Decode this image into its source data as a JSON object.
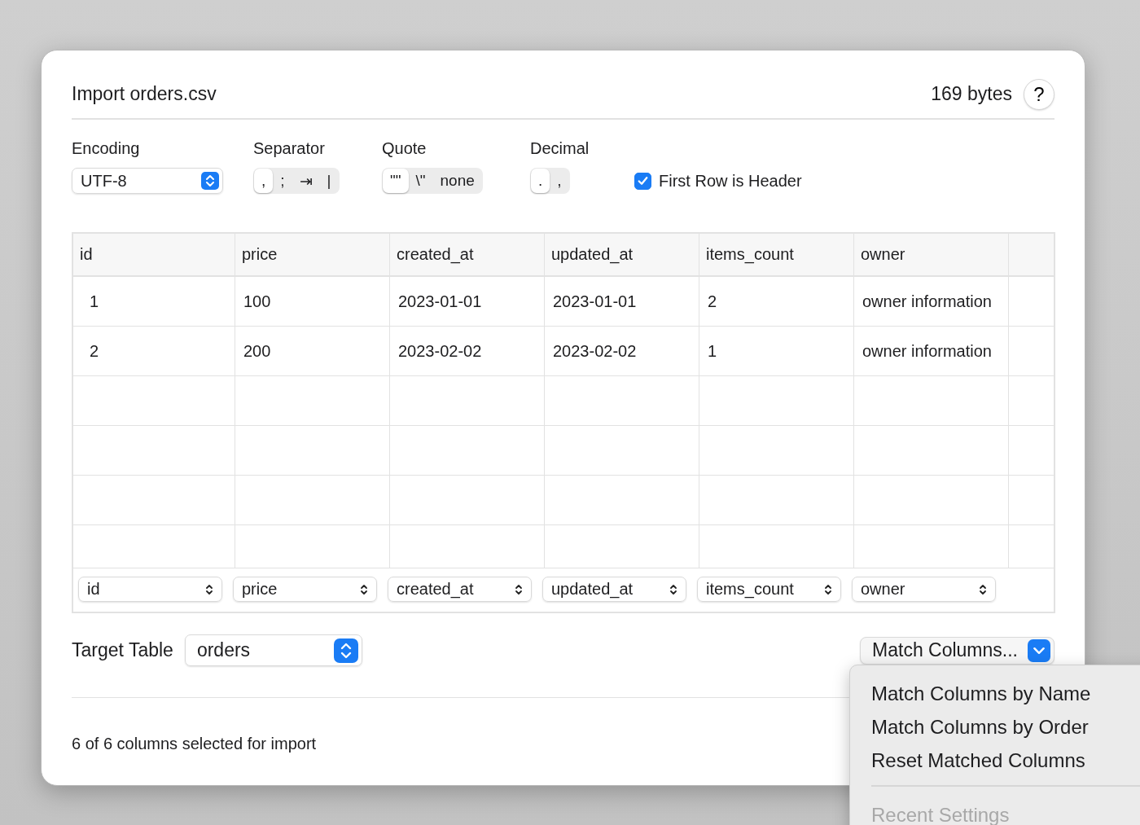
{
  "dialog": {
    "title": "Import orders.csv",
    "size": "169 bytes",
    "help": "?"
  },
  "options": {
    "encoding": {
      "label": "Encoding",
      "value": "UTF-8"
    },
    "separator": {
      "label": "Separator",
      "segments": [
        {
          "label": ",",
          "selected": true
        },
        {
          "label": ";",
          "selected": false
        },
        {
          "label": "⇥",
          "selected": false
        },
        {
          "label": "|",
          "selected": false
        }
      ]
    },
    "quote": {
      "label": "Quote",
      "segments": [
        {
          "label": "\"\"",
          "selected": true
        },
        {
          "label": "\\\"",
          "selected": false
        },
        {
          "label": "none",
          "selected": false
        }
      ]
    },
    "decimal": {
      "label": "Decimal",
      "segments": [
        {
          "label": ".",
          "selected": true
        },
        {
          "label": ",",
          "selected": false
        }
      ]
    },
    "header_checkbox": {
      "label": "First Row is Header",
      "checked": true
    }
  },
  "table": {
    "columns": [
      "id",
      "price",
      "created_at",
      "updated_at",
      "items_count",
      "owner"
    ],
    "rows": [
      [
        "1",
        "100",
        "2023-01-01",
        "2023-01-01",
        "2",
        "owner information"
      ],
      [
        "2",
        "200",
        "2023-02-02",
        "2023-02-02",
        "1",
        "owner information"
      ]
    ],
    "mappings": [
      "id",
      "price",
      "created_at",
      "updated_at",
      "items_count",
      "owner"
    ]
  },
  "target": {
    "label": "Target Table",
    "value": "orders"
  },
  "match_button": {
    "label": "Match Columns..."
  },
  "status": "6 of 6 columns selected for import",
  "menu": {
    "items": [
      {
        "kind": "item",
        "label": "Match Columns by Name",
        "disabled": false
      },
      {
        "kind": "item",
        "label": "Match Columns by Order",
        "disabled": false
      },
      {
        "kind": "item",
        "label": "Reset Matched Columns",
        "disabled": false
      },
      {
        "kind": "separator"
      },
      {
        "kind": "item",
        "label": "Recent Settings",
        "disabled": true
      }
    ]
  }
}
